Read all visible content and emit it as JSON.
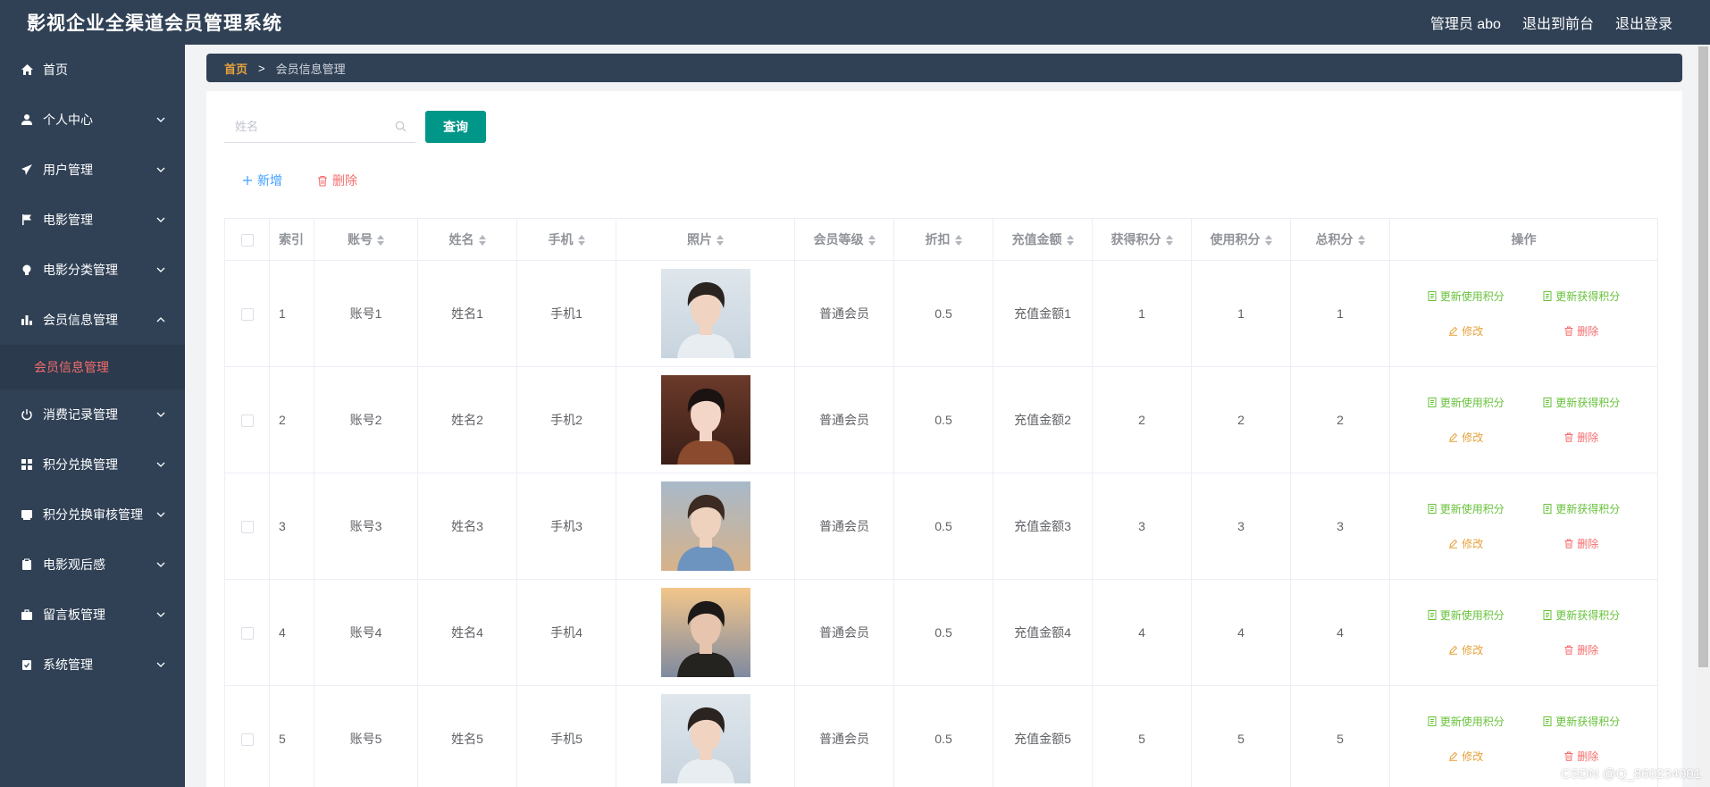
{
  "header": {
    "title": "影视企业全渠道会员管理系统",
    "admin_label": "管理员 abo",
    "to_front": "退出到前台",
    "logout": "退出登录"
  },
  "sidebar": {
    "items": [
      {
        "label": "首页",
        "icon": "home-icon"
      },
      {
        "label": "个人中心",
        "icon": "user-icon"
      },
      {
        "label": "用户管理",
        "icon": "send-icon"
      },
      {
        "label": "电影管理",
        "icon": "flag-icon"
      },
      {
        "label": "电影分类管理",
        "icon": "bulb-icon"
      },
      {
        "label": "会员信息管理",
        "icon": "bar-chart-icon"
      },
      {
        "label": "消费记录管理",
        "icon": "power-icon"
      },
      {
        "label": "积分兑换管理",
        "icon": "grid-icon"
      },
      {
        "label": "积分兑换审核管理",
        "icon": "card-icon"
      },
      {
        "label": "电影观后感",
        "icon": "clipboard-icon"
      },
      {
        "label": "留言板管理",
        "icon": "briefcase-icon"
      },
      {
        "label": "系统管理",
        "icon": "checklist-icon"
      }
    ],
    "submenu_label": "会员信息管理"
  },
  "breadcrumb": {
    "home": "首页",
    "separator": ">",
    "current": "会员信息管理"
  },
  "search": {
    "placeholder": "姓名",
    "value": "",
    "button": "查询"
  },
  "actions": {
    "add": "新增",
    "delete": "删除"
  },
  "table": {
    "columns": [
      "索引",
      "账号",
      "姓名",
      "手机",
      "照片",
      "会员等级",
      "折扣",
      "充值金额",
      "获得积分",
      "使用积分",
      "总积分",
      "操作"
    ],
    "rows": [
      {
        "index": "1",
        "account": "账号1",
        "name": "姓名1",
        "phone": "手机1",
        "level": "普通会员",
        "discount": "0.5",
        "recharge": "充值金额1",
        "earned": "1",
        "used": "1",
        "total": "1"
      },
      {
        "index": "2",
        "account": "账号2",
        "name": "姓名2",
        "phone": "手机2",
        "level": "普通会员",
        "discount": "0.5",
        "recharge": "充值金额2",
        "earned": "2",
        "used": "2",
        "total": "2"
      },
      {
        "index": "3",
        "account": "账号3",
        "name": "姓名3",
        "phone": "手机3",
        "level": "普通会员",
        "discount": "0.5",
        "recharge": "充值金额3",
        "earned": "3",
        "used": "3",
        "total": "3"
      },
      {
        "index": "4",
        "account": "账号4",
        "name": "姓名4",
        "phone": "手机4",
        "level": "普通会员",
        "discount": "0.5",
        "recharge": "充值金额4",
        "earned": "4",
        "used": "4",
        "total": "4"
      },
      {
        "index": "5",
        "account": "账号5",
        "name": "姓名5",
        "phone": "手机5",
        "level": "普通会员",
        "discount": "0.5",
        "recharge": "充值金额5",
        "earned": "5",
        "used": "5",
        "total": "5"
      }
    ],
    "row_ops": {
      "update_used": "更新使用积分",
      "update_earned": "更新获得积分",
      "edit": "修改",
      "delete": "删除"
    }
  },
  "watermark": "CSDN @Q_860234001",
  "colors": {
    "header_bg": "#304156",
    "sidebar_bg": "#304156",
    "accent_green": "#009688",
    "link_blue": "#409eff",
    "danger_red": "#f56c6c",
    "warning_yellow": "#e6a23c",
    "success_green": "#67c23a"
  }
}
